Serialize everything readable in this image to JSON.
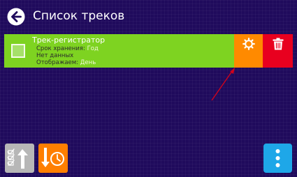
{
  "header": {
    "title": "Список треков",
    "back_icon": "arrow-left-circle-icon"
  },
  "track": {
    "name": "Трек-регистратор",
    "storage_label": "Срок хранения:",
    "storage_value": "Год",
    "no_data": "Нет данных",
    "display_label": "Отображаем:",
    "display_value": "День",
    "colors": {
      "row": "#7ed321",
      "settings": "#ff8a00",
      "delete": "#e8001f"
    },
    "icons": {
      "checkbox": "checkbox-icon",
      "settings": "gear-icon",
      "delete": "trash-icon"
    }
  },
  "annotation": {
    "color": "#d0021b",
    "icon": "red-arrow-icon"
  },
  "bottom_bar": {
    "export_icon": "checklist-upload-icon",
    "stats_icon": "download-clock-icon",
    "menu_icon": "vertical-dots-icon",
    "colors": {
      "export": "#b7b7b7",
      "stats": "#ff7f00",
      "menu": "#1ea7e8"
    }
  }
}
